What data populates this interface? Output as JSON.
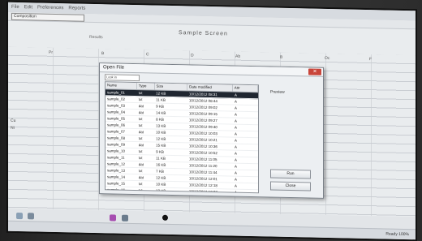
{
  "menubar": {
    "items": [
      "File",
      "Edit",
      "Preferences",
      "Reports"
    ]
  },
  "toolbar": {
    "dropdown_value": "Composition"
  },
  "document": {
    "title": "Sample Screen",
    "tab_label": "Results"
  },
  "columns": [
    "Pr",
    "B",
    "C",
    "D",
    "Ab",
    "B",
    "Oc",
    "F"
  ],
  "left_values": [
    "Cu",
    "Ni"
  ],
  "dialog": {
    "title": "Open File",
    "close_label": "✕",
    "filter_placeholder": "Look in",
    "right_label": "Preview",
    "headers": [
      "Name",
      "Type",
      "Size",
      "Date modified",
      "Attr"
    ],
    "rows": [
      [
        "sample_01",
        "txt",
        "12 KB",
        "10/12/2012 08:31",
        "A"
      ],
      [
        "sample_02",
        "txt",
        "11 KB",
        "10/12/2012 08:44",
        "A"
      ],
      [
        "sample_03",
        "dat",
        "9 KB",
        "10/12/2012 09:02",
        "A"
      ],
      [
        "sample_04",
        "dat",
        "14 KB",
        "10/12/2012 09:15",
        "A"
      ],
      [
        "sample_05",
        "txt",
        "8 KB",
        "10/12/2012 09:27",
        "A"
      ],
      [
        "sample_06",
        "txt",
        "13 KB",
        "10/12/2012 09:40",
        "A"
      ],
      [
        "sample_07",
        "dat",
        "10 KB",
        "10/12/2012 10:03",
        "A"
      ],
      [
        "sample_08",
        "txt",
        "12 KB",
        "10/12/2012 10:21",
        "A"
      ],
      [
        "sample_09",
        "dat",
        "15 KB",
        "10/12/2012 10:36",
        "A"
      ],
      [
        "sample_10",
        "txt",
        "9 KB",
        "10/12/2012 10:52",
        "A"
      ],
      [
        "sample_11",
        "txt",
        "11 KB",
        "10/12/2012 11:05",
        "A"
      ],
      [
        "sample_12",
        "dat",
        "16 KB",
        "10/12/2012 11:20",
        "A"
      ],
      [
        "sample_13",
        "txt",
        "7 KB",
        "10/12/2012 11:44",
        "A"
      ],
      [
        "sample_14",
        "dat",
        "12 KB",
        "10/12/2012 12:01",
        "A"
      ],
      [
        "sample_15",
        "txt",
        "10 KB",
        "10/12/2012 12:18",
        "A"
      ],
      [
        "sample_16",
        "txt",
        "13 KB",
        "10/12/2012 12:37",
        "A"
      ]
    ],
    "selected_row": 0,
    "buttons": {
      "run": "Run",
      "close": "Close"
    }
  },
  "statusbar": {
    "right_text": "Ready  100%"
  },
  "colors": {
    "selection": "#1f2630",
    "close_button": "#c9453a"
  }
}
